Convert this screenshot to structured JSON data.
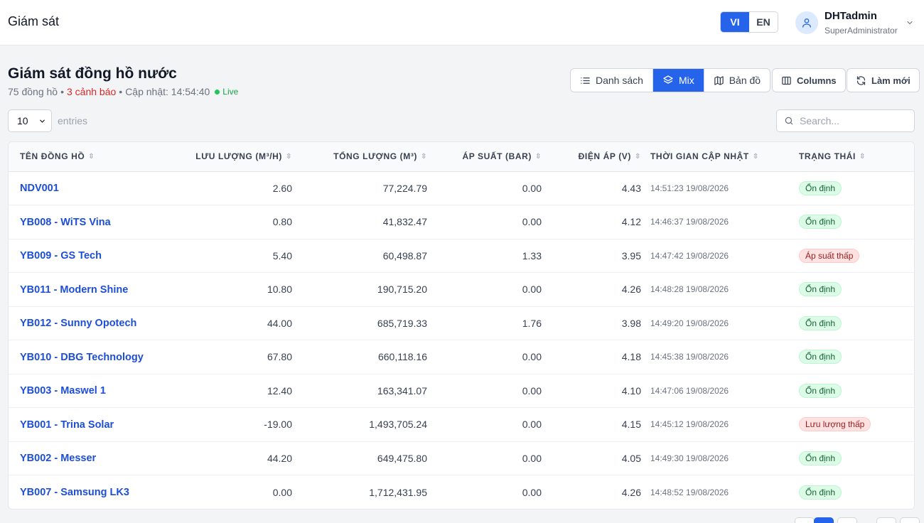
{
  "header": {
    "app_title": "Giám sát",
    "languages": [
      {
        "code": "VI",
        "active": true
      },
      {
        "code": "EN",
        "active": false
      }
    ],
    "user": {
      "name": "DHTadmin",
      "role": "SuperAdministrator"
    }
  },
  "page": {
    "title": "Giám sát đồng hồ nước",
    "meter_count": "75 đồng hồ",
    "separator": "•",
    "alerts": "3 cảnh báo",
    "updated": "Cập nhật: 14:54:40",
    "live": "Live"
  },
  "views": [
    {
      "label": "Danh sách",
      "icon": "list-icon",
      "active": false
    },
    {
      "label": "Mix",
      "icon": "layers-icon",
      "active": true
    },
    {
      "label": "Bản đồ",
      "icon": "map-icon",
      "active": false
    }
  ],
  "toolbar": {
    "columns_label": "Columns",
    "refresh_label": "Làm mới"
  },
  "controls": {
    "page_size": "10",
    "entries_label": "entries",
    "search_placeholder": "Search..."
  },
  "colors": {
    "primary": "#2563eb",
    "link": "#1d4ed8",
    "alert": "#dc2626",
    "live": "#22c55e"
  },
  "table": {
    "columns": [
      "TÊN ĐỒNG HỒ",
      "LƯU LƯỢNG (M³/H)",
      "TỔNG LƯỢNG (M³)",
      "ÁP SUẤT (BAR)",
      "ĐIỆN ÁP (V)",
      "THỜI GIAN CẬP NHẬT",
      "TRẠNG THÁI"
    ],
    "rows": [
      {
        "name": "NDV001",
        "flow": "2.60",
        "total": "77,224.79",
        "pressure": "0.00",
        "voltage": "4.43",
        "time": "14:51:23 19/08/2026",
        "status": "Ổn định",
        "status_type": "ok"
      },
      {
        "name": "YB008 - WiTS Vina",
        "flow": "0.80",
        "total": "41,832.47",
        "pressure": "0.00",
        "voltage": "4.12",
        "time": "14:46:37 19/08/2026",
        "status": "Ổn định",
        "status_type": "ok"
      },
      {
        "name": "YB009 - GS Tech",
        "flow": "5.40",
        "total": "60,498.87",
        "pressure": "1.33",
        "voltage": "3.95",
        "time": "14:47:42 19/08/2026",
        "status": "Áp suất thấp",
        "status_type": "bad"
      },
      {
        "name": "YB011 - Modern Shine",
        "flow": "10.80",
        "total": "190,715.20",
        "pressure": "0.00",
        "voltage": "4.26",
        "time": "14:48:28 19/08/2026",
        "status": "Ổn định",
        "status_type": "ok"
      },
      {
        "name": "YB012 - Sunny Opotech",
        "flow": "44.00",
        "total": "685,719.33",
        "pressure": "1.76",
        "voltage": "3.98",
        "time": "14:49:20 19/08/2026",
        "status": "Ổn định",
        "status_type": "ok"
      },
      {
        "name": "YB010 - DBG Technology",
        "flow": "67.80",
        "total": "660,118.16",
        "pressure": "0.00",
        "voltage": "4.18",
        "time": "14:45:38 19/08/2026",
        "status": "Ổn định",
        "status_type": "ok"
      },
      {
        "name": "YB003 - Maswel 1",
        "flow": "12.40",
        "total": "163,341.07",
        "pressure": "0.00",
        "voltage": "4.10",
        "time": "14:47:06 19/08/2026",
        "status": "Ổn định",
        "status_type": "ok"
      },
      {
        "name": "YB001 - Trina Solar",
        "flow": "-19.00",
        "total": "1,493,705.24",
        "pressure": "0.00",
        "voltage": "4.15",
        "time": "14:45:12 19/08/2026",
        "status": "Lưu lượng thấp",
        "status_type": "bad"
      },
      {
        "name": "YB002 - Messer",
        "flow": "44.20",
        "total": "649,475.80",
        "pressure": "0.00",
        "voltage": "4.05",
        "time": "14:49:30 19/08/2026",
        "status": "Ổn định",
        "status_type": "ok"
      },
      {
        "name": "YB007 - Samsung LK3",
        "flow": "0.00",
        "total": "1,712,431.95",
        "pressure": "0.00",
        "voltage": "4.26",
        "time": "14:48:52 19/08/2026",
        "status": "Ổn định",
        "status_type": "ok"
      }
    ]
  }
}
